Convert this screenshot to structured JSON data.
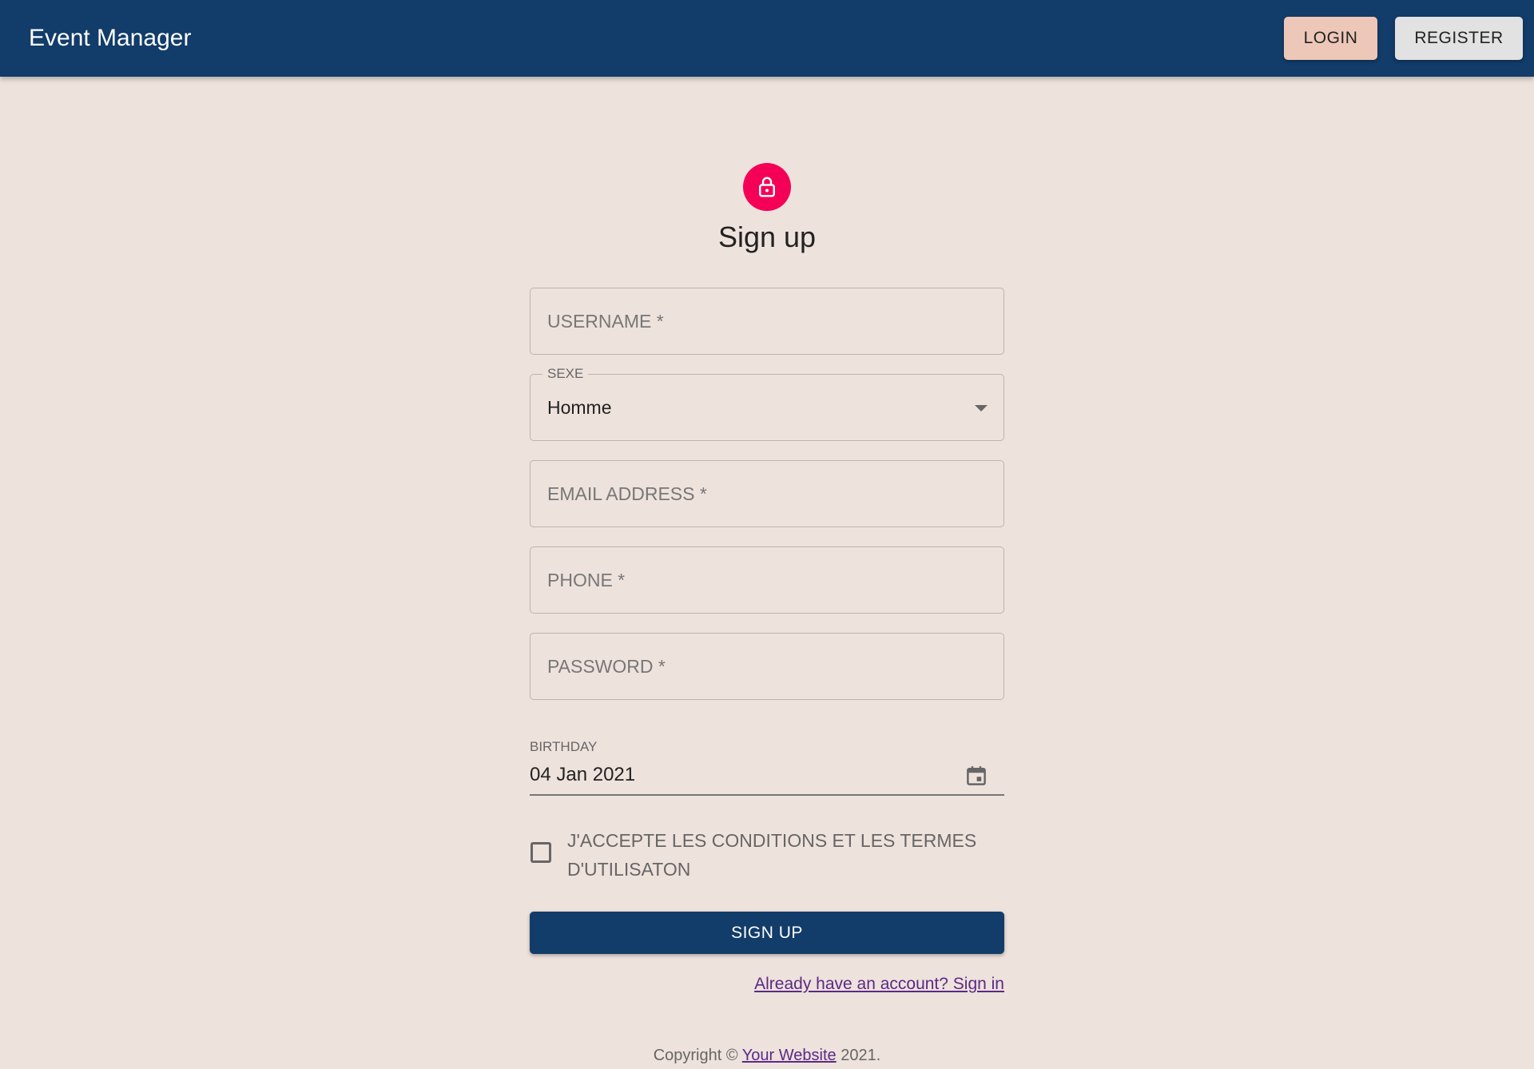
{
  "app": {
    "title": "Event Manager"
  },
  "nav": {
    "login": "LOGIN",
    "register": "REGISTER"
  },
  "form": {
    "heading": "Sign up",
    "username_placeholder": "USERNAME *",
    "sexe_label": "SEXE",
    "sexe_value": "Homme",
    "email_placeholder": "EMAIL ADDRESS *",
    "phone_placeholder": "PHONE *",
    "password_placeholder": "PASSWORD *",
    "birthday_label": "BIRTHDAY",
    "birthday_value": "04 Jan 2021",
    "terms_label": "J'ACCEPTE LES CONDITIONS ET LES TERMES D'UTILISATON",
    "terms_checked": false,
    "submit_label": "SIGN UP",
    "signin_link": "Already have an account? Sign in"
  },
  "footer": {
    "prefix": "Copyright ©",
    "link": "Your Website",
    "suffix": "2021."
  },
  "colors": {
    "appbar": "#123c69",
    "background": "#eee2dc",
    "accent": "#f50057",
    "login_button": "#edc7b7",
    "link": "#5b2a86"
  },
  "icons": {
    "avatar": "lock-icon",
    "date": "calendar-icon",
    "select": "chevron-down-icon"
  }
}
